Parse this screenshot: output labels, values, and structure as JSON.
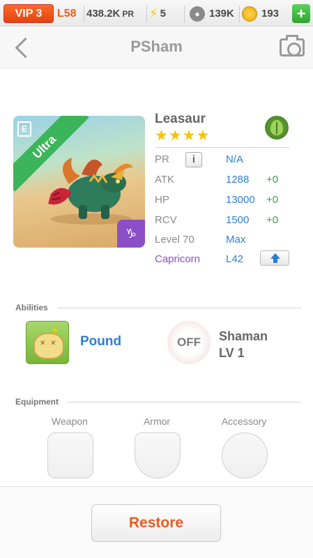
{
  "topbar": {
    "vip": "VIP 3",
    "level": "L58",
    "power": "438.2K",
    "power_unit": "PR",
    "energy": "5",
    "food": "139K",
    "gold": "193",
    "add_label": "+"
  },
  "header": {
    "title": "PSham"
  },
  "monster": {
    "rarity": "Ultra",
    "name": "Leasaur",
    "stars": "★★★★",
    "element_icon": "leaf-icon",
    "zodiac_icon": "capricorn-icon",
    "stats": {
      "pr_label": "PR",
      "pr_value": "N/A",
      "info_label": "i",
      "atk_label": "ATK",
      "atk_value": "1288",
      "atk_bonus": "+0",
      "hp_label": "HP",
      "hp_value": "13000",
      "hp_bonus": "+0",
      "rcv_label": "RCV",
      "rcv_value": "1500",
      "rcv_bonus": "+0",
      "level_label": "Level 70",
      "level_value": "Max",
      "sign_label": "Capricorn",
      "sign_value": "L42"
    }
  },
  "abilities": {
    "title": "Abilities",
    "primary": "Pound",
    "secondary_state": "OFF",
    "secondary_name": "Shaman",
    "secondary_level": "LV 1"
  },
  "equipment": {
    "title": "Equipment",
    "weapon": "Weapon",
    "armor": "Armor",
    "accessory": "Accessory"
  },
  "footer": {
    "restore": "Restore"
  },
  "colors": {
    "accent_orange": "#ee5a1e",
    "stat_blue": "#2d7fd6",
    "bonus_green": "#33a24a",
    "ultra_green": "#3cb55a"
  }
}
